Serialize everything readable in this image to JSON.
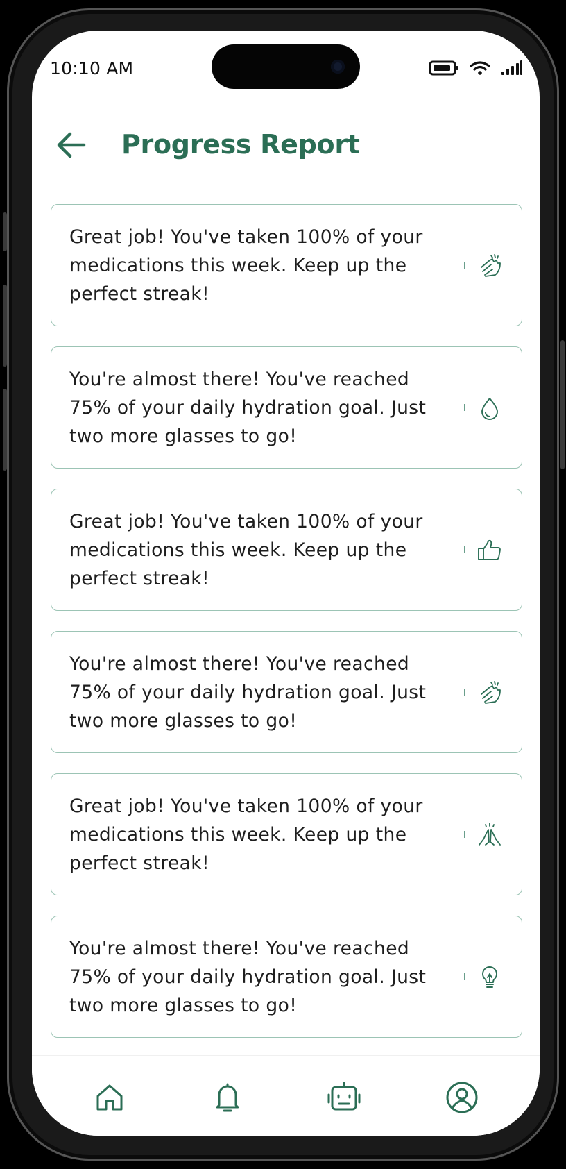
{
  "status_bar": {
    "time": "10:10 AM"
  },
  "header": {
    "title": "Progress Report",
    "back_icon": "arrow-left-icon"
  },
  "cards": [
    {
      "text": "Great job! You've taken 100% of your medications this week. Keep up the perfect streak!",
      "icon": "clapping-hands-icon"
    },
    {
      "text": "You're almost there! You've reached 75% of your daily hydration goal. Just two more glasses to go!",
      "icon": "water-drop-icon"
    },
    {
      "text": "Great job! You've taken 100% of your medications this week. Keep up the perfect streak!",
      "icon": "thumbs-up-icon"
    },
    {
      "text": "You're almost there! You've reached 75% of your daily hydration goal. Just two more glasses to go!",
      "icon": "clapping-hands-icon"
    },
    {
      "text": "Great job! You've taken 100% of your medications this week. Keep up the perfect streak!",
      "icon": "praying-hands-icon"
    },
    {
      "text": "You're almost there! You've reached 75% of your daily hydration goal. Just two more glasses to go!",
      "icon": "lightbulb-icon"
    }
  ],
  "bottom_nav": [
    {
      "icon": "home-icon"
    },
    {
      "icon": "bell-icon"
    },
    {
      "icon": "robot-icon"
    },
    {
      "icon": "profile-icon"
    }
  ],
  "colors": {
    "accent": "#2b6e55",
    "card_border": "#9cc4b5",
    "text": "#1e1e1e"
  }
}
